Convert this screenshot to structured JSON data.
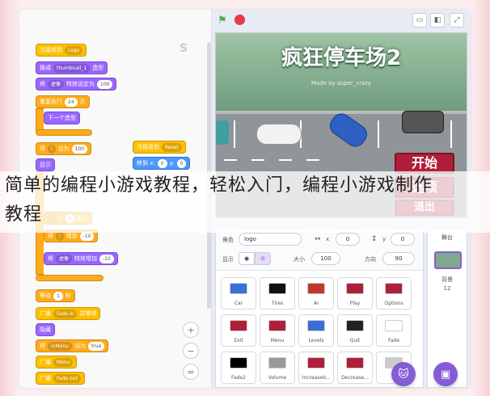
{
  "caption": {
    "line1": "简单的编程小游戏教程，轻松入门，编程小游戏制作",
    "line2": "教程"
  },
  "code_blocks": {
    "b1": {
      "label": "当接收到",
      "value": "Logo"
    },
    "b2": {
      "label": "换成",
      "value": "thumbnail_1",
      "suffix": "造型"
    },
    "b3": {
      "label": "将",
      "value": "虚像",
      "mid": "特效设定为",
      "num": "100"
    },
    "b4": {
      "label": "重复执行",
      "num": "24",
      "suffix": "次"
    },
    "b5": {
      "label": "下一个造型"
    },
    "b6": {
      "label": "将",
      "var": "i",
      "mid": "设为",
      "num": "100"
    },
    "b7": {
      "label": "显示"
    },
    "b8": {
      "label": "",
      "n1": "i",
      "op": "=",
      "n2": "0",
      "suffix": "那么"
    },
    "b9": {
      "label": "将",
      "var": "i",
      "mid": "增加",
      "num": "-10"
    },
    "b10": {
      "label": "将",
      "value": "虚像",
      "mid": "特效增加",
      "num": "-10"
    },
    "b11": {
      "label": "等待",
      "num": "1",
      "suffix": "秒"
    },
    "b12": {
      "label": "广播",
      "value": "Fade in",
      "suffix": "并等待"
    },
    "b13": {
      "label": "隐藏"
    },
    "b14": {
      "label": "将",
      "var": "inMenu",
      "mid": "设为",
      "num": "true"
    },
    "b15": {
      "label": "广播",
      "value": "Menu"
    },
    "b16": {
      "label": "广播",
      "value": "Fade out"
    },
    "r1": {
      "label": "当接收到",
      "value": "Reset"
    },
    "r2": {
      "label": "移到 x:",
      "x": "0",
      "ylabel": "y:",
      "y": "0"
    }
  },
  "stage": {
    "title": "疯狂停车场2",
    "subtitle": "Made by super_crazy",
    "start_button": "开始",
    "options_button": "选项",
    "exit_button": "退出"
  },
  "sprite_info": {
    "sprite_label": "角色",
    "sprite_name": "logo",
    "x_label": "x",
    "x_value": "0",
    "y_label": "y",
    "y_value": "0",
    "show_label": "显示",
    "size_label": "大小",
    "size_value": "100",
    "direction_label": "方向",
    "direction_value": "90"
  },
  "sprites": [
    {
      "name": "Car",
      "color": "#3b6fd6"
    },
    {
      "name": "Tires",
      "color": "#111111"
    },
    {
      "name": "Ai",
      "color": "#c0392b"
    },
    {
      "name": "Play",
      "color": "#b01f3a"
    },
    {
      "name": "Options",
      "color": "#b01f3a"
    },
    {
      "name": "Exit",
      "color": "#b01f3a"
    },
    {
      "name": "Menu",
      "color": "#b01f3a"
    },
    {
      "name": "Levels",
      "color": "#3b6fd6"
    },
    {
      "name": "Quit",
      "color": "#222222"
    },
    {
      "name": "Fade",
      "color": "#ffffff"
    },
    {
      "name": "Fade2",
      "color": "#000000"
    },
    {
      "name": "Volume",
      "color": "#999999"
    },
    {
      "name": "IncreaseV...",
      "color": "#b01f3a"
    },
    {
      "name": "Decrease...",
      "color": "#b01f3a"
    },
    {
      "name": "",
      "color": "#cccccc"
    }
  ],
  "backdrop": {
    "label": "舞台",
    "sub_label": "背景",
    "count": "12"
  }
}
